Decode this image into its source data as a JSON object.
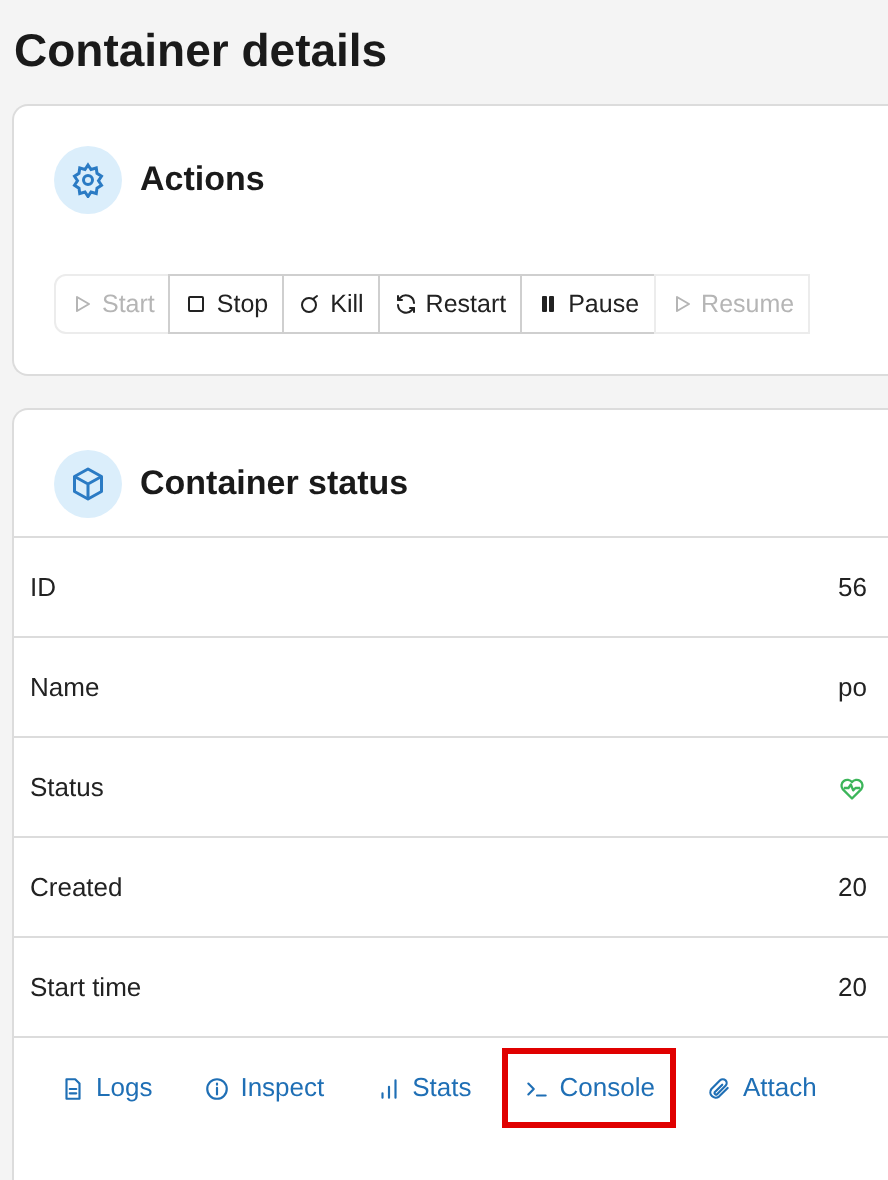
{
  "page_title": "Container details",
  "actions": {
    "title": "Actions",
    "buttons": [
      {
        "kind": "play",
        "label": "Start",
        "disabled": true
      },
      {
        "kind": "stop",
        "label": "Stop",
        "disabled": false
      },
      {
        "kind": "kill",
        "label": "Kill",
        "disabled": false
      },
      {
        "kind": "restart",
        "label": "Restart",
        "disabled": false
      },
      {
        "kind": "pause",
        "label": "Pause",
        "disabled": false
      },
      {
        "kind": "play",
        "label": "Resume",
        "disabled": true
      }
    ]
  },
  "status": {
    "title": "Container status",
    "rows": [
      {
        "label": "ID",
        "value": "56"
      },
      {
        "label": "Name",
        "value": "po"
      },
      {
        "label": "Status",
        "kind": "healthy"
      },
      {
        "label": "Created",
        "value": "20"
      },
      {
        "label": "Start time",
        "value": "20"
      }
    ],
    "links": [
      {
        "kind": "logs",
        "label": "Logs",
        "highlighted": false
      },
      {
        "kind": "inspect",
        "label": "Inspect",
        "highlighted": false
      },
      {
        "kind": "stats",
        "label": "Stats",
        "highlighted": false
      },
      {
        "kind": "console",
        "label": "Console",
        "highlighted": true
      },
      {
        "kind": "attach",
        "label": "Attach",
        "highlighted": false
      }
    ]
  }
}
